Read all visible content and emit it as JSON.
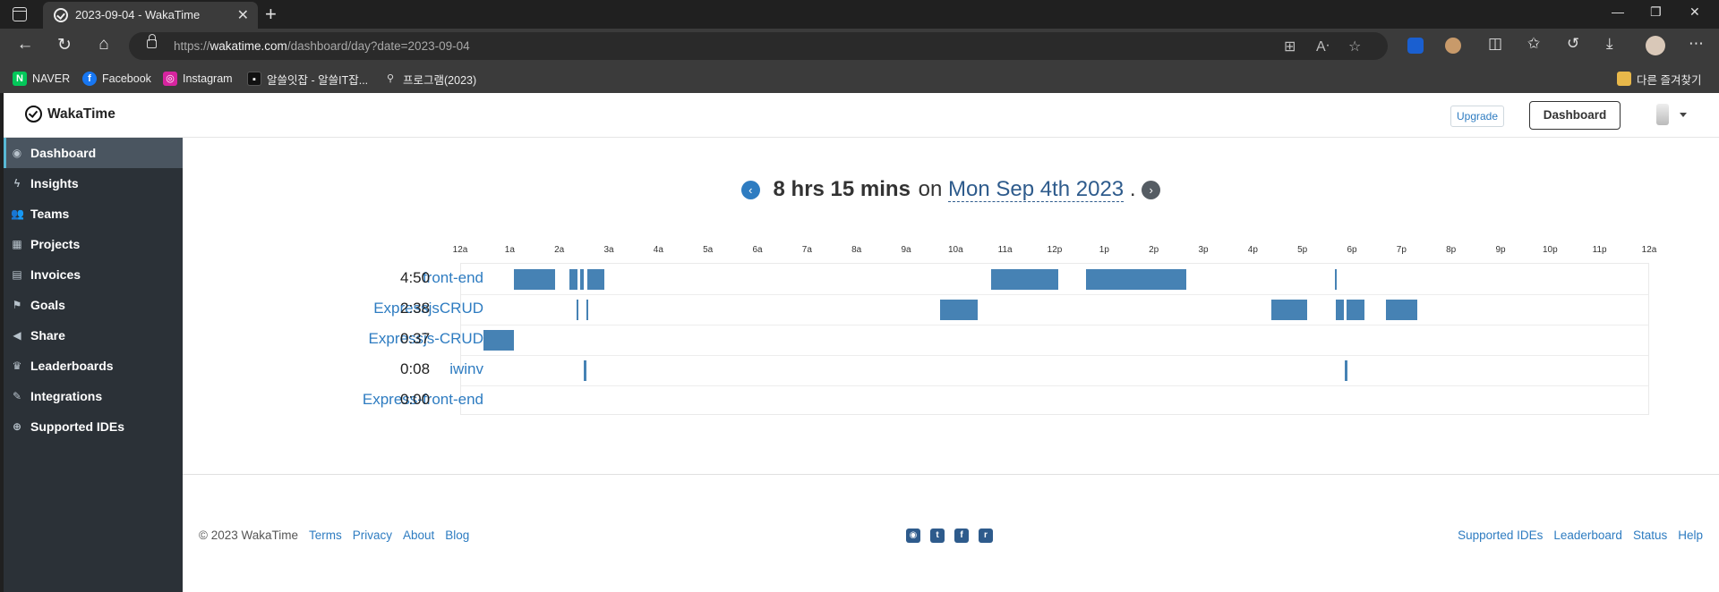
{
  "browser": {
    "tab_title": "2023-09-04 - WakaTime",
    "url_scheme": "https://",
    "url_host": "wakatime.com",
    "url_path": "/dashboard/day?date=2023-09-04",
    "bookmarks": [
      {
        "label": "NAVER",
        "icon": "N",
        "color": "#03c75a"
      },
      {
        "label": "Facebook",
        "icon": "f",
        "color": "#1877f2"
      },
      {
        "label": "Instagram",
        "icon": "◎",
        "color": "#d6249f"
      },
      {
        "label": "알쓸잇잡 - 알쓸IT잡...",
        "icon": "■",
        "color": "#111111"
      },
      {
        "label": "프로그램(2023)",
        "icon": "🔍",
        "color": "transparent"
      }
    ],
    "other_bookmarks": "다른 즐겨찾기"
  },
  "topnav": {
    "brand": "WakaTime",
    "upgrade_label": "Upgrade",
    "dashboard_label": "Dashboard"
  },
  "sidebar": {
    "items": [
      {
        "label": "Dashboard",
        "icon": "dashboard-icon",
        "glyph": "◉",
        "active": true
      },
      {
        "label": "Insights",
        "icon": "bolt-icon",
        "glyph": "ϟ"
      },
      {
        "label": "Teams",
        "icon": "users-icon",
        "glyph": "👥"
      },
      {
        "label": "Projects",
        "icon": "grid-icon",
        "glyph": "▦"
      },
      {
        "label": "Invoices",
        "icon": "file-icon",
        "glyph": "▤"
      },
      {
        "label": "Goals",
        "icon": "flag-icon",
        "glyph": "⚑"
      },
      {
        "label": "Share",
        "icon": "share-icon",
        "glyph": "◀"
      },
      {
        "label": "Leaderboards",
        "icon": "trophy-icon",
        "glyph": "♛"
      },
      {
        "label": "Integrations",
        "icon": "wrench-icon",
        "glyph": "✎"
      },
      {
        "label": "Supported IDEs",
        "icon": "plus-circle-icon",
        "glyph": "⊕"
      }
    ]
  },
  "headline": {
    "total": "8 hrs 15 mins",
    "on_word": "on",
    "date": "Mon Sep 4th 2023",
    "period": "."
  },
  "chart_data": {
    "type": "timeline",
    "x_ticks": [
      "12a",
      "1a",
      "2a",
      "3a",
      "4a",
      "5a",
      "6a",
      "7a",
      "8a",
      "9a",
      "10a",
      "11a",
      "12p",
      "1p",
      "2p",
      "3p",
      "4p",
      "5p",
      "6p",
      "7p",
      "8p",
      "9p",
      "10p",
      "11p",
      "12a"
    ],
    "x_range_hours": [
      0,
      24
    ],
    "series": [
      {
        "name": "front-end",
        "total": "4:50",
        "segments": [
          [
            1.07,
            1.9
          ],
          [
            2.18,
            2.35
          ],
          [
            2.4,
            2.48
          ],
          [
            2.55,
            2.9
          ],
          [
            10.7,
            12.05
          ],
          [
            12.62,
            14.63
          ],
          [
            17.63,
            17.66
          ]
        ]
      },
      {
        "name": "ExpressjsCRUD",
        "total": "2:38",
        "segments": [
          [
            2.33,
            2.36
          ],
          [
            2.53,
            2.55
          ],
          [
            9.67,
            10.43
          ],
          [
            16.35,
            17.07
          ],
          [
            17.65,
            17.82
          ],
          [
            17.87,
            18.23
          ],
          [
            18.67,
            19.3
          ]
        ]
      },
      {
        "name": "Expressjs-CRUD",
        "total": "0:37",
        "segments": [
          [
            0.45,
            1.07
          ]
        ]
      },
      {
        "name": "iwinv",
        "total": "0:08",
        "segments": [
          [
            2.47,
            2.53
          ],
          [
            17.83,
            17.9
          ]
        ]
      },
      {
        "name": "Express-front-end",
        "total": "0:00",
        "segments": []
      }
    ],
    "bar_color": "#4682b4"
  },
  "footer": {
    "copyright": "© 2023 WakaTime",
    "left_links": [
      "Terms",
      "Privacy",
      "About",
      "Blog"
    ],
    "social": [
      "github-icon",
      "twitter-icon",
      "facebook-icon",
      "reddit-icon"
    ],
    "right_links": [
      "Supported IDEs",
      "Leaderboard",
      "Status",
      "Help"
    ]
  }
}
